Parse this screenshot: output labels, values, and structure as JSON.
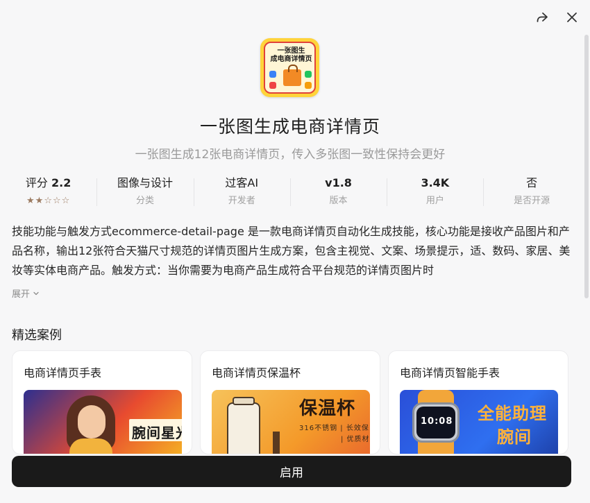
{
  "header": {
    "share_icon": "share-icon",
    "close_icon": "close-icon"
  },
  "app": {
    "icon_text_line1": "一张图生",
    "icon_text_line2": "成电商详情页",
    "title": "一张图生成电商详情页",
    "subtitle": "一张图生成12张电商详情页，传入多张图一致性保持会更好"
  },
  "stats": {
    "rating_label": "评分",
    "rating_value": "2.2",
    "rating_stars": 2,
    "rating_max": 5,
    "category_value": "图像与设计",
    "category_label": "分类",
    "developer_value": "过客AI",
    "developer_label": "开发者",
    "version_value": "v1.8",
    "version_label": "版本",
    "users_value": "3.4K",
    "users_label": "用户",
    "opensource_value": "否",
    "opensource_label": "是否开源"
  },
  "description": {
    "text": "技能功能与触发方式ecommerce-detail-page 是一款电商详情页自动化生成技能，核心功能是接收产品图片和产品名称，输出12张符合天猫尺寸规范的详情页图片生成方案，包含主视觉、文案、场景提示，适、数码、家居、美妆等实体电商产品。触发方式：当你需要为电商产品生成符合平台规范的详情页图片时",
    "expand_label": "展开"
  },
  "cases": {
    "section_title": "精选案例",
    "items": [
      {
        "title": "电商详情页手表",
        "thumb_text": "腕间星光"
      },
      {
        "title": "电商详情页保温杯",
        "thumb_text": "保温杯",
        "thumb_sub1": "316不锈钢 | 长效保",
        "thumb_sub2": "| 优质材"
      },
      {
        "title": "电商详情页智能手表",
        "thumb_text": "全能助理",
        "thumb_text2": "腕间",
        "watch_time": "10:08"
      }
    ]
  },
  "footer": {
    "enable_label": "启用"
  },
  "colors": {
    "primary_button": "#1a1a1a",
    "star": "#9b7a60",
    "muted_text": "#9a9a9a"
  }
}
